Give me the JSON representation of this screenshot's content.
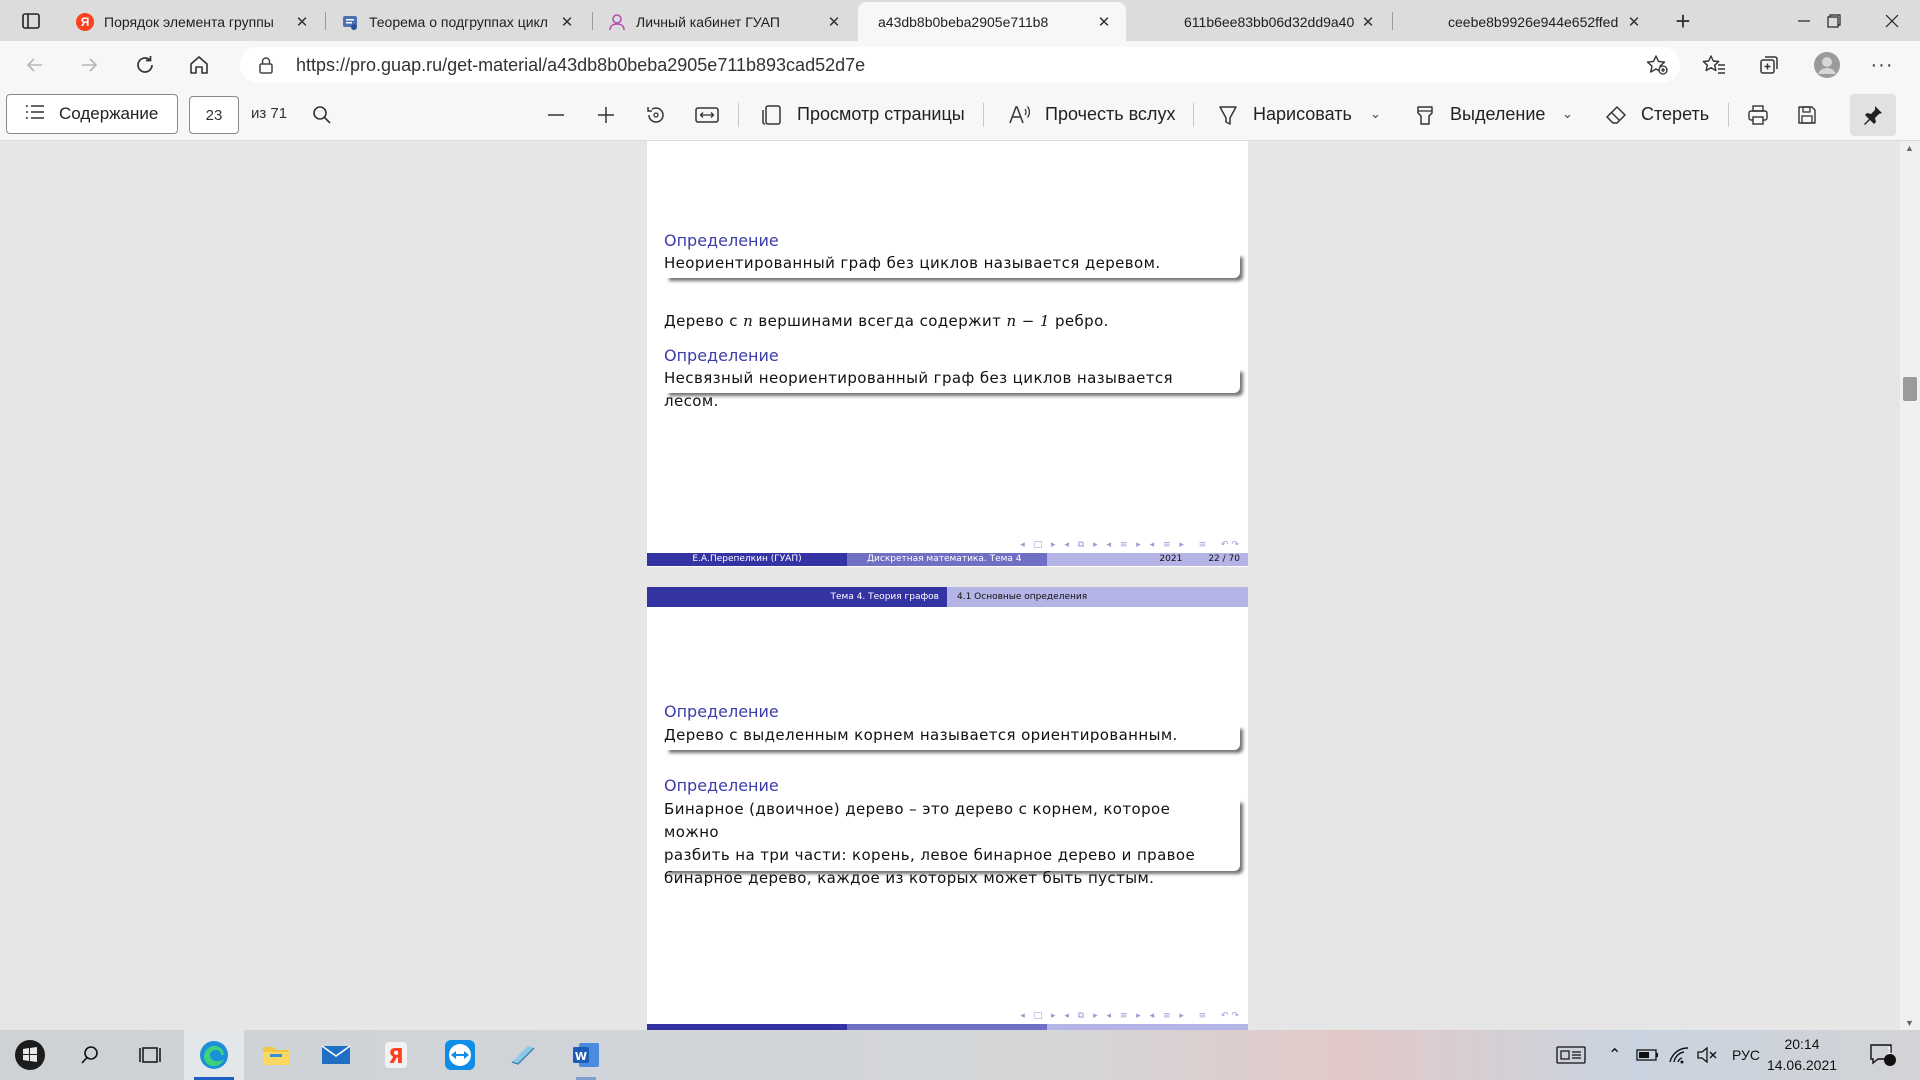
{
  "tabs": [
    {
      "title": "Порядок элемента группы",
      "favicon": "yandex",
      "active": false
    },
    {
      "title": "Теорема о подгруппах цикл",
      "favicon": "doc",
      "active": false
    },
    {
      "title": "Личный кабинет ГУАП",
      "favicon": "user",
      "active": false
    },
    {
      "title": "a43db8b0beba2905e711b8",
      "favicon": "none",
      "active": true
    },
    {
      "title": "611b6ee83bb06d32dd9a40",
      "favicon": "none",
      "active": false
    },
    {
      "title": "ceebe8b9926e944e652ffed",
      "favicon": "none",
      "active": false
    }
  ],
  "address": {
    "url": "https://pro.guap.ru/get-material/a43db8b0beba2905e711b893cad52d7e"
  },
  "pdf_toolbar": {
    "contents_label": "Содержание",
    "page_current": "23",
    "page_total": "из 71",
    "page_view_label": "Просмотр страницы",
    "read_aloud_label": "Прочесть вслух",
    "draw_label": "Нарисовать",
    "highlight_label": "Выделение",
    "erase_label": "Стереть"
  },
  "slide_a": {
    "def1_title": "Определение",
    "def1_body": "Неориентированный граф без циклов называется деревом.",
    "plain_pre": "Дерево с ",
    "plain_n": "n",
    "plain_mid": " вершинами всегда содержит ",
    "plain_expr": "n − 1",
    "plain_post": " ребро.",
    "def2_title": "Определение",
    "def2_body": "Несвязный неориентированный граф без циклов называется лесом.",
    "footer_author": "Е.А.Перепелкин  (ГУАП)",
    "footer_course": "Дискретная математика. Тема 4",
    "footer_year": "2021",
    "footer_page": "22 / 70"
  },
  "slide_b": {
    "header_topic": "Тема 4. Теория графов",
    "header_section": "4.1 Основные определения",
    "def1_title": "Определение",
    "def1_body": "Дерево с выделенным корнем называется ориентированным.",
    "def2_title": "Определение",
    "def2_line1": "Бинарное (двоичное) дерево – это дерево с корнем, которое можно",
    "def2_line2": "разбить на три части: корень, левое бинарное дерево и правое",
    "def2_line3": "бинарное дерево, каждое из которых может быть пустым."
  },
  "taskbar": {
    "language": "РУС",
    "time": "20:14",
    "date": "14.06.2021",
    "notifications": "1"
  },
  "colors": {
    "beamer_dark": "#3333a3",
    "beamer_light": "#b4b4e6",
    "def_title": "#3d3da8"
  }
}
